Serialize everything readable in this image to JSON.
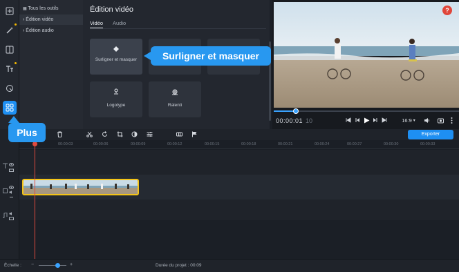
{
  "sidebar_tree": {
    "items": [
      {
        "label": "Tous les outils"
      },
      {
        "label": "Édition vidéo"
      },
      {
        "label": "Édition audio"
      }
    ]
  },
  "panel": {
    "title": "Édition vidéo",
    "tabs": [
      "Vidéo",
      "Audio"
    ],
    "active_tab": "Vidéo",
    "cards": [
      {
        "label": "Surligner et masquer",
        "icon": "diamond-icon"
      },
      {
        "label": "Logotype",
        "icon": "logo-stamp-icon"
      },
      {
        "label": "Ralenti",
        "icon": "slow-motion-snail-icon"
      }
    ]
  },
  "callouts": {
    "highlight": "Surligner et masquer",
    "more": "Plus"
  },
  "player": {
    "help": "?",
    "timecode": "00:00:01",
    "timecode_dim": "10",
    "aspect": "16:9",
    "progress": 0.12
  },
  "toolbar": {
    "export_label": "Exporter"
  },
  "ruler": {
    "ticks": [
      "00:00:00",
      "00:00:03",
      "00:00:06",
      "00:00:09",
      "00:00:12",
      "00:00:15",
      "00:00:18",
      "00:00:21",
      "00:00:24",
      "00:00:27",
      "00:00:30",
      "00:00:33"
    ]
  },
  "status": {
    "scale_label": "Échelle :",
    "duration_label": "Durée du projet :",
    "duration_value": "00:09"
  },
  "colors": {
    "accent": "#1e8ff2",
    "callout": "#2898f0",
    "playhead": "#e04a3e",
    "clip_border": "#f5c518",
    "help": "#e0463a"
  }
}
